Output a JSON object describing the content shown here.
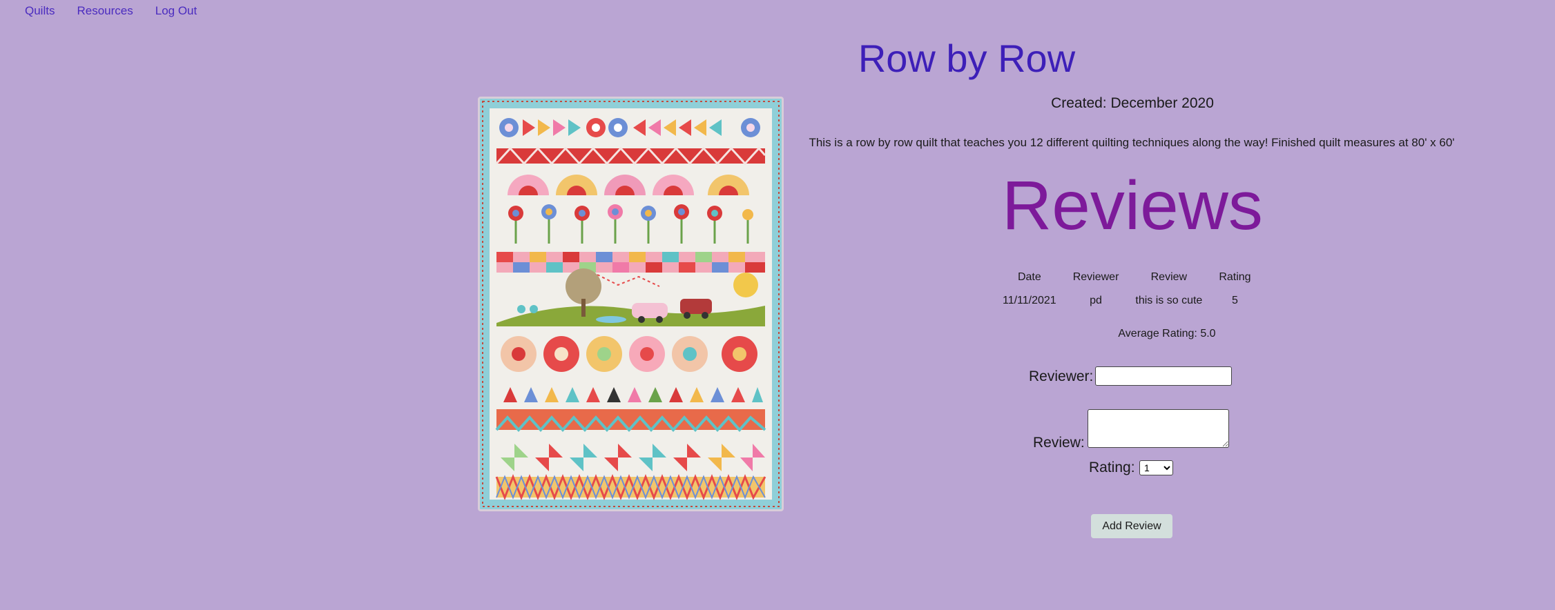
{
  "nav": {
    "items": [
      {
        "label": "Quilts"
      },
      {
        "label": "Resources"
      },
      {
        "label": "Log Out"
      }
    ]
  },
  "quilt": {
    "title": "Row by Row",
    "created": "Created: December 2020",
    "description": "This is a row by row quilt that teaches you 12 different quilting techniques along the way! Finished quilt measures at 80' x 60'"
  },
  "reviews": {
    "heading": "Reviews",
    "columns": [
      "Date",
      "Reviewer",
      "Review",
      "Rating"
    ],
    "rows": [
      {
        "date": "11/11/2021",
        "reviewer": "pd",
        "review": "this is so cute",
        "rating": "5"
      }
    ],
    "average": "Average Rating: 5.0"
  },
  "form": {
    "reviewer_label": "Reviewer:",
    "reviewer_value": "",
    "review_label": "Review:",
    "review_value": "",
    "rating_label": "Rating:",
    "rating_selected": "1",
    "submit_label": "Add Review"
  },
  "colors": {
    "background": "#baa5d3",
    "link": "#4a2bbf",
    "title": "#3d1fb8",
    "reviews_heading": "#7d1a9a",
    "button": "#d3dfdc"
  }
}
